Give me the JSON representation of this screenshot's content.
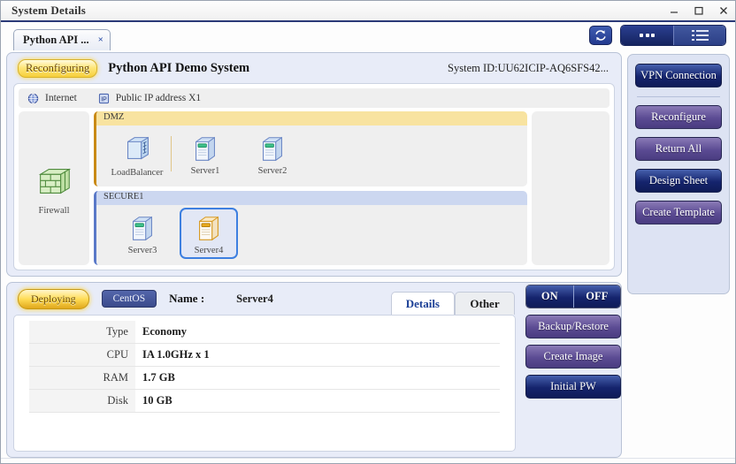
{
  "window": {
    "title": "System Details",
    "controls": [
      {
        "name": "minimize-button",
        "glyph": "–"
      },
      {
        "name": "maximize-button",
        "glyph": "□"
      },
      {
        "name": "close-button",
        "glyph": "✕"
      }
    ]
  },
  "tabstrip": {
    "tab_label": "Python API ...",
    "tab_close": "×",
    "refresh_icon": "refresh-icon",
    "view_icon_mode": "icon-view",
    "view_list_mode": "list-view"
  },
  "system": {
    "status_badge": "Reconfiguring",
    "title": "Python API Demo System",
    "system_id": "System ID:UU62ICIP-AQ6SFS42..."
  },
  "network": {
    "internet_label": "Internet",
    "public_ip_label": "Public IP address X1",
    "public_ip_icon_text": "IP",
    "firewall_label": "Firewall",
    "zones": [
      {
        "name": "DMZ",
        "nodes": [
          {
            "label": "LoadBalancer",
            "type": "loadbalancer",
            "selected": false
          },
          {
            "label": "Server1",
            "type": "server",
            "selected": false
          },
          {
            "label": "Server2",
            "type": "server",
            "selected": false
          }
        ]
      },
      {
        "name": "SECURE1",
        "nodes": [
          {
            "label": "Server3",
            "type": "server",
            "selected": false
          },
          {
            "label": "Server4",
            "type": "server",
            "selected": true
          }
        ]
      }
    ]
  },
  "details": {
    "status_badge": "Deploying",
    "os_badge": "CentOS",
    "name_label": "Name :",
    "name_value": "Server4",
    "tabs": [
      {
        "label": "Details",
        "active": true
      },
      {
        "label": "Other",
        "active": false
      }
    ],
    "properties": [
      {
        "key": "Type",
        "value": "Economy"
      },
      {
        "key": "CPU",
        "value": "IA 1.0GHz x 1"
      },
      {
        "key": "RAM",
        "value": "1.7 GB"
      },
      {
        "key": "Disk",
        "value": "10 GB"
      }
    ]
  },
  "rail": {
    "buttons": [
      {
        "label": "VPN Connection",
        "style": "blue"
      },
      {
        "label": "Reconfigure",
        "style": "purple"
      },
      {
        "label": "Return All",
        "style": "purple"
      },
      {
        "label": "Design Sheet",
        "style": "blue"
      },
      {
        "label": "Create Template",
        "style": "purple"
      }
    ]
  },
  "power": {
    "on_label": "ON",
    "off_label": "OFF",
    "buttons": [
      {
        "label": "Backup/Restore",
        "style": "purple"
      },
      {
        "label": "Create Image",
        "style": "purple"
      },
      {
        "label": "Initial PW",
        "style": "blue"
      }
    ]
  },
  "colors": {
    "accent_blue": "#15246d",
    "accent_purple": "#5b4b93",
    "status_gold": "#ffdc55",
    "dmz_header": "#f8e3a0",
    "secure_header": "#ccd7f0",
    "selection_border": "#3d7fe0"
  }
}
